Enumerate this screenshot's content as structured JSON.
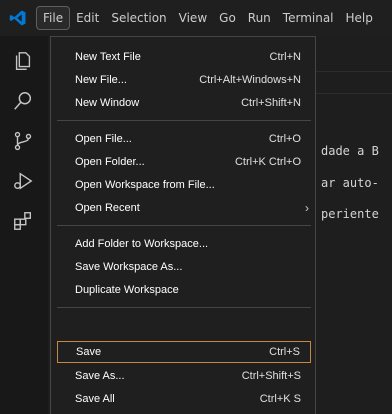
{
  "menubar": {
    "items": [
      "File",
      "Edit",
      "Selection",
      "View",
      "Go",
      "Run",
      "Terminal",
      "Help"
    ]
  },
  "editor": {
    "lines": [
      "dade a B",
      "ar auto-",
      "periente"
    ]
  },
  "file_menu": {
    "groups": [
      [
        {
          "label": "New Text File",
          "shortcut": "Ctrl+N"
        },
        {
          "label": "New File...",
          "shortcut": "Ctrl+Alt+Windows+N"
        },
        {
          "label": "New Window",
          "shortcut": "Ctrl+Shift+N"
        }
      ],
      [
        {
          "label": "Open File...",
          "shortcut": "Ctrl+O"
        },
        {
          "label": "Open Folder...",
          "shortcut": "Ctrl+K Ctrl+O"
        },
        {
          "label": "Open Workspace from File...",
          "shortcut": ""
        },
        {
          "label": "Open Recent",
          "shortcut": "",
          "submenu": true
        }
      ],
      [
        {
          "label": "Add Folder to Workspace...",
          "shortcut": ""
        },
        {
          "label": "Save Workspace As...",
          "shortcut": ""
        },
        {
          "label": "Duplicate Workspace",
          "shortcut": ""
        }
      ],
      [
        {
          "label": "Save",
          "shortcut": "Ctrl+S",
          "focused": true
        },
        {
          "label": "Save As...",
          "shortcut": "Ctrl+Shift+S"
        },
        {
          "label": "Save All",
          "shortcut": "Ctrl+K S"
        }
      ]
    ]
  },
  "colors": {
    "accent": "#0078d4",
    "focus_border": "#c28a46"
  }
}
